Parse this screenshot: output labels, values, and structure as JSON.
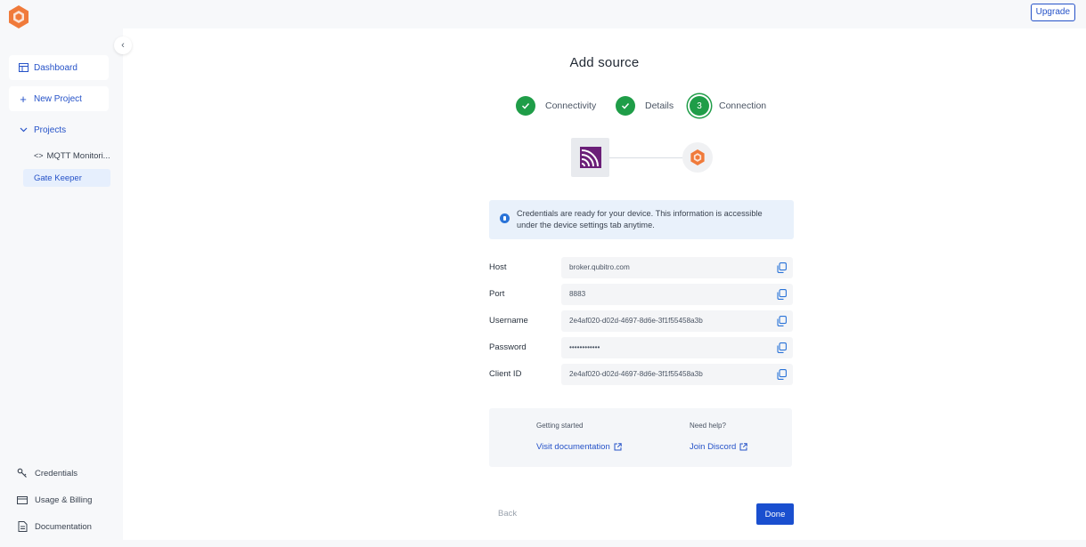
{
  "header": {
    "upgrade_label": "Upgrade"
  },
  "sidebar": {
    "dashboard": "Dashboard",
    "new_project": "New Project",
    "projects": "Projects",
    "project_items": [
      "MQTT Monitori...",
      "Gate Keeper"
    ],
    "bottom_items": [
      "Credentials",
      "Usage & Billing",
      "Documentation"
    ]
  },
  "main": {
    "title": "Add source",
    "steps": [
      {
        "label": "Connectivity",
        "state": "done"
      },
      {
        "label": "Details",
        "state": "done"
      },
      {
        "label": "Connection",
        "state": "current",
        "number": "3"
      }
    ],
    "info_line1": "Credentials are ready for your device. This information is accessible",
    "info_line2": "under the device settings tab anytime.",
    "credentials": [
      {
        "label": "Host",
        "value": "broker.qubitro.com"
      },
      {
        "label": "Port",
        "value": "8883"
      },
      {
        "label": "Username",
        "value": "2e4af020-d02d-4697-8d6e-3f1f55458a3b"
      },
      {
        "label": "Password",
        "value": "••••••••••••"
      },
      {
        "label": "Client ID",
        "value": "2e4af020-d02d-4697-8d6e-3f1f55458a3b"
      }
    ],
    "help": {
      "getting_started": "Getting started",
      "visit_docs": "Visit documentation",
      "need_help": "Need help?",
      "join_discord": "Join Discord"
    },
    "back_label": "Back",
    "done_label": "Done"
  },
  "colors": {
    "accent": "#2552c8",
    "success": "#1f9d48",
    "brand": "#f07a3a"
  }
}
